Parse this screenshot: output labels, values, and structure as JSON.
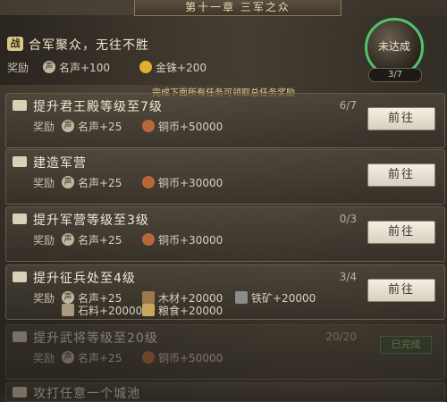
{
  "chapter": {
    "title": "第十一章 三军之众"
  },
  "header": {
    "icon_text": "战",
    "title": "合军聚众，无往不胜",
    "reward_label": "奖励",
    "rewards": [
      {
        "icon": "fame-icon",
        "text": "名声+100"
      },
      {
        "icon": "gold-icon",
        "text": "金铢+200"
      }
    ],
    "hint": "完成下面所有任务可领取总任务奖励",
    "badge_status": "未达成",
    "badge_progress": "3/7"
  },
  "quests": [
    {
      "title": "提升君王殿等级至7级",
      "progress": "6/7",
      "reward_label": "奖励",
      "rewards": [
        "名声+25",
        "铜币+50000"
      ],
      "button": "前往"
    },
    {
      "title": "建造军营",
      "progress": "",
      "reward_label": "奖励",
      "rewards": [
        "名声+25",
        "铜币+30000"
      ],
      "button": "前往"
    },
    {
      "title": "提升军营等级至3级",
      "progress": "0/3",
      "reward_label": "奖励",
      "rewards": [
        "名声+25",
        "铜币+30000"
      ],
      "button": "前往"
    },
    {
      "title": "提升征兵处至4级",
      "progress": "3/4",
      "reward_label": "奖励",
      "rewards": [
        "名声+25",
        "木材+20000",
        "铁矿+20000",
        "石料+20000",
        "粮食+20000"
      ],
      "button": "前往"
    },
    {
      "title": "提升武将等级至20级",
      "progress": "20/20",
      "reward_label": "奖励",
      "rewards": [
        "名声+25",
        "铜币+50000"
      ],
      "button": "已完成"
    },
    {
      "title": "攻打任意一个城池"
    }
  ],
  "colors": {
    "accent_green": "#5bbf6a",
    "gold": "#e6d08a"
  }
}
